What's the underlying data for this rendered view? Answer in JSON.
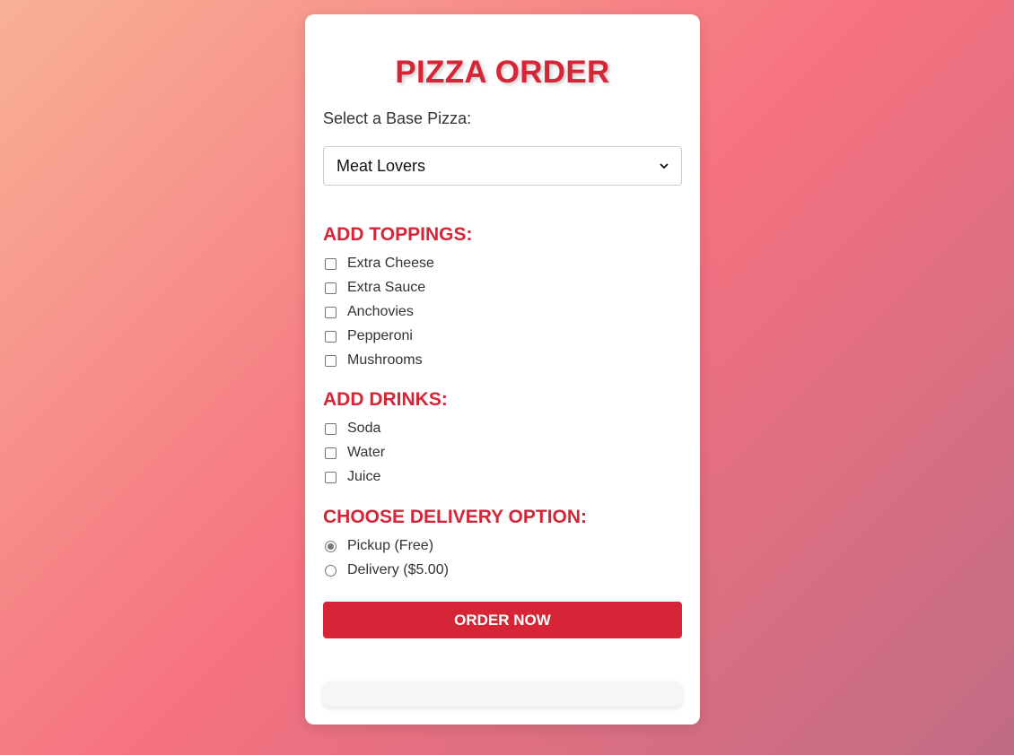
{
  "title": "PIZZA ORDER",
  "base": {
    "label": "Select a Base Pizza:",
    "selected": "Meat Lovers"
  },
  "toppings": {
    "heading": "ADD TOPPINGS:",
    "items": [
      "Extra Cheese",
      "Extra Sauce",
      "Anchovies",
      "Pepperoni",
      "Mushrooms"
    ]
  },
  "drinks": {
    "heading": "ADD DRINKS:",
    "items": [
      "Soda",
      "Water",
      "Juice"
    ]
  },
  "delivery": {
    "heading": "CHOOSE DELIVERY OPTION:",
    "options": [
      "Pickup (Free)",
      "Delivery ($5.00)"
    ],
    "selected": "Pickup (Free)"
  },
  "order_button_label": "ORDER NOW",
  "colors": {
    "accent": "#d62536",
    "background_start": "#f8b195",
    "background_mid": "#f67280",
    "background_end": "#c06c84"
  }
}
